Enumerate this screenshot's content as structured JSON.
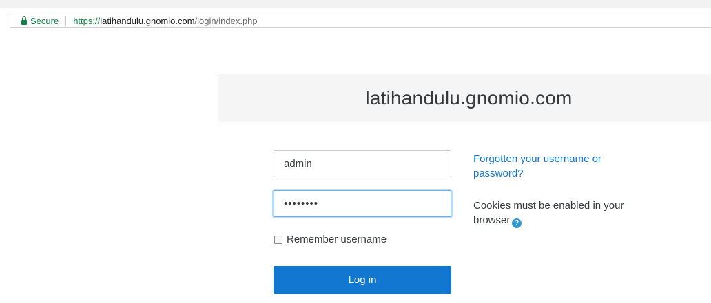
{
  "browser": {
    "secure_label": "Secure",
    "url_scheme": "https://",
    "url_host": "latihandulu.gnomio.com",
    "url_path": "/login/index.php",
    "lock_icon": "lock-icon",
    "secure_color": "#0b8043"
  },
  "login": {
    "site_title": "latihandulu.gnomio.com",
    "username_value": "admin",
    "password_value": "••••••••",
    "remember_label": "Remember username",
    "remember_checked": false,
    "login_button_label": "Log in",
    "forgot_link": "Forgotten your username or password?",
    "cookies_text": "Cookies must be enabled in your browser",
    "help_icon": "help-icon",
    "help_icon_glyph": "?",
    "accent_color": "#1177d1"
  }
}
